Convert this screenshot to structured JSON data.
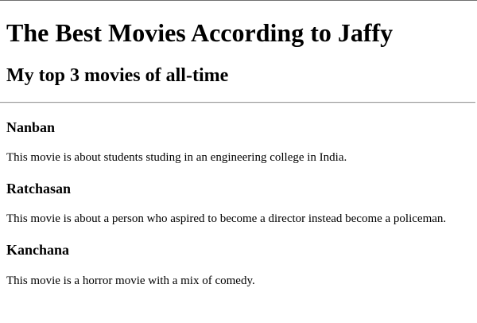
{
  "page": {
    "title": "The Best Movies According to Jaffy",
    "subtitle": "My top 3 movies of all-time"
  },
  "movies": [
    {
      "title": "Nanban",
      "description": "This movie is about students studing in an engineering college in India."
    },
    {
      "title": "Ratchasan",
      "description": "This movie is about a person who aspired to become a director instead become a policeman."
    },
    {
      "title": "Kanchana",
      "description": "This movie is a horror movie with a mix of comedy."
    }
  ]
}
